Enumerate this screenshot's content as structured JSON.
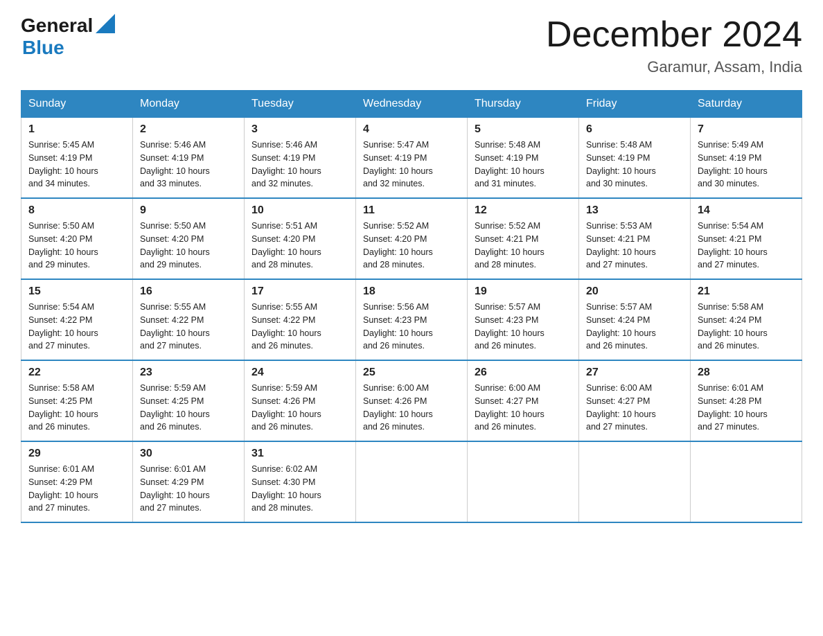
{
  "header": {
    "logo_general": "General",
    "logo_blue": "Blue",
    "month_title": "December 2024",
    "location": "Garamur, Assam, India"
  },
  "days_of_week": [
    "Sunday",
    "Monday",
    "Tuesday",
    "Wednesday",
    "Thursday",
    "Friday",
    "Saturday"
  ],
  "weeks": [
    [
      {
        "day": "1",
        "sunrise": "Sunrise: 5:45 AM",
        "sunset": "Sunset: 4:19 PM",
        "daylight": "Daylight: 10 hours and 34 minutes."
      },
      {
        "day": "2",
        "sunrise": "Sunrise: 5:46 AM",
        "sunset": "Sunset: 4:19 PM",
        "daylight": "Daylight: 10 hours and 33 minutes."
      },
      {
        "day": "3",
        "sunrise": "Sunrise: 5:46 AM",
        "sunset": "Sunset: 4:19 PM",
        "daylight": "Daylight: 10 hours and 32 minutes."
      },
      {
        "day": "4",
        "sunrise": "Sunrise: 5:47 AM",
        "sunset": "Sunset: 4:19 PM",
        "daylight": "Daylight: 10 hours and 32 minutes."
      },
      {
        "day": "5",
        "sunrise": "Sunrise: 5:48 AM",
        "sunset": "Sunset: 4:19 PM",
        "daylight": "Daylight: 10 hours and 31 minutes."
      },
      {
        "day": "6",
        "sunrise": "Sunrise: 5:48 AM",
        "sunset": "Sunset: 4:19 PM",
        "daylight": "Daylight: 10 hours and 30 minutes."
      },
      {
        "day": "7",
        "sunrise": "Sunrise: 5:49 AM",
        "sunset": "Sunset: 4:19 PM",
        "daylight": "Daylight: 10 hours and 30 minutes."
      }
    ],
    [
      {
        "day": "8",
        "sunrise": "Sunrise: 5:50 AM",
        "sunset": "Sunset: 4:20 PM",
        "daylight": "Daylight: 10 hours and 29 minutes."
      },
      {
        "day": "9",
        "sunrise": "Sunrise: 5:50 AM",
        "sunset": "Sunset: 4:20 PM",
        "daylight": "Daylight: 10 hours and 29 minutes."
      },
      {
        "day": "10",
        "sunrise": "Sunrise: 5:51 AM",
        "sunset": "Sunset: 4:20 PM",
        "daylight": "Daylight: 10 hours and 28 minutes."
      },
      {
        "day": "11",
        "sunrise": "Sunrise: 5:52 AM",
        "sunset": "Sunset: 4:20 PM",
        "daylight": "Daylight: 10 hours and 28 minutes."
      },
      {
        "day": "12",
        "sunrise": "Sunrise: 5:52 AM",
        "sunset": "Sunset: 4:21 PM",
        "daylight": "Daylight: 10 hours and 28 minutes."
      },
      {
        "day": "13",
        "sunrise": "Sunrise: 5:53 AM",
        "sunset": "Sunset: 4:21 PM",
        "daylight": "Daylight: 10 hours and 27 minutes."
      },
      {
        "day": "14",
        "sunrise": "Sunrise: 5:54 AM",
        "sunset": "Sunset: 4:21 PM",
        "daylight": "Daylight: 10 hours and 27 minutes."
      }
    ],
    [
      {
        "day": "15",
        "sunrise": "Sunrise: 5:54 AM",
        "sunset": "Sunset: 4:22 PM",
        "daylight": "Daylight: 10 hours and 27 minutes."
      },
      {
        "day": "16",
        "sunrise": "Sunrise: 5:55 AM",
        "sunset": "Sunset: 4:22 PM",
        "daylight": "Daylight: 10 hours and 27 minutes."
      },
      {
        "day": "17",
        "sunrise": "Sunrise: 5:55 AM",
        "sunset": "Sunset: 4:22 PM",
        "daylight": "Daylight: 10 hours and 26 minutes."
      },
      {
        "day": "18",
        "sunrise": "Sunrise: 5:56 AM",
        "sunset": "Sunset: 4:23 PM",
        "daylight": "Daylight: 10 hours and 26 minutes."
      },
      {
        "day": "19",
        "sunrise": "Sunrise: 5:57 AM",
        "sunset": "Sunset: 4:23 PM",
        "daylight": "Daylight: 10 hours and 26 minutes."
      },
      {
        "day": "20",
        "sunrise": "Sunrise: 5:57 AM",
        "sunset": "Sunset: 4:24 PM",
        "daylight": "Daylight: 10 hours and 26 minutes."
      },
      {
        "day": "21",
        "sunrise": "Sunrise: 5:58 AM",
        "sunset": "Sunset: 4:24 PM",
        "daylight": "Daylight: 10 hours and 26 minutes."
      }
    ],
    [
      {
        "day": "22",
        "sunrise": "Sunrise: 5:58 AM",
        "sunset": "Sunset: 4:25 PM",
        "daylight": "Daylight: 10 hours and 26 minutes."
      },
      {
        "day": "23",
        "sunrise": "Sunrise: 5:59 AM",
        "sunset": "Sunset: 4:25 PM",
        "daylight": "Daylight: 10 hours and 26 minutes."
      },
      {
        "day": "24",
        "sunrise": "Sunrise: 5:59 AM",
        "sunset": "Sunset: 4:26 PM",
        "daylight": "Daylight: 10 hours and 26 minutes."
      },
      {
        "day": "25",
        "sunrise": "Sunrise: 6:00 AM",
        "sunset": "Sunset: 4:26 PM",
        "daylight": "Daylight: 10 hours and 26 minutes."
      },
      {
        "day": "26",
        "sunrise": "Sunrise: 6:00 AM",
        "sunset": "Sunset: 4:27 PM",
        "daylight": "Daylight: 10 hours and 26 minutes."
      },
      {
        "day": "27",
        "sunrise": "Sunrise: 6:00 AM",
        "sunset": "Sunset: 4:27 PM",
        "daylight": "Daylight: 10 hours and 27 minutes."
      },
      {
        "day": "28",
        "sunrise": "Sunrise: 6:01 AM",
        "sunset": "Sunset: 4:28 PM",
        "daylight": "Daylight: 10 hours and 27 minutes."
      }
    ],
    [
      {
        "day": "29",
        "sunrise": "Sunrise: 6:01 AM",
        "sunset": "Sunset: 4:29 PM",
        "daylight": "Daylight: 10 hours and 27 minutes."
      },
      {
        "day": "30",
        "sunrise": "Sunrise: 6:01 AM",
        "sunset": "Sunset: 4:29 PM",
        "daylight": "Daylight: 10 hours and 27 minutes."
      },
      {
        "day": "31",
        "sunrise": "Sunrise: 6:02 AM",
        "sunset": "Sunset: 4:30 PM",
        "daylight": "Daylight: 10 hours and 28 minutes."
      },
      {
        "day": "",
        "sunrise": "",
        "sunset": "",
        "daylight": ""
      },
      {
        "day": "",
        "sunrise": "",
        "sunset": "",
        "daylight": ""
      },
      {
        "day": "",
        "sunrise": "",
        "sunset": "",
        "daylight": ""
      },
      {
        "day": "",
        "sunrise": "",
        "sunset": "",
        "daylight": ""
      }
    ]
  ]
}
